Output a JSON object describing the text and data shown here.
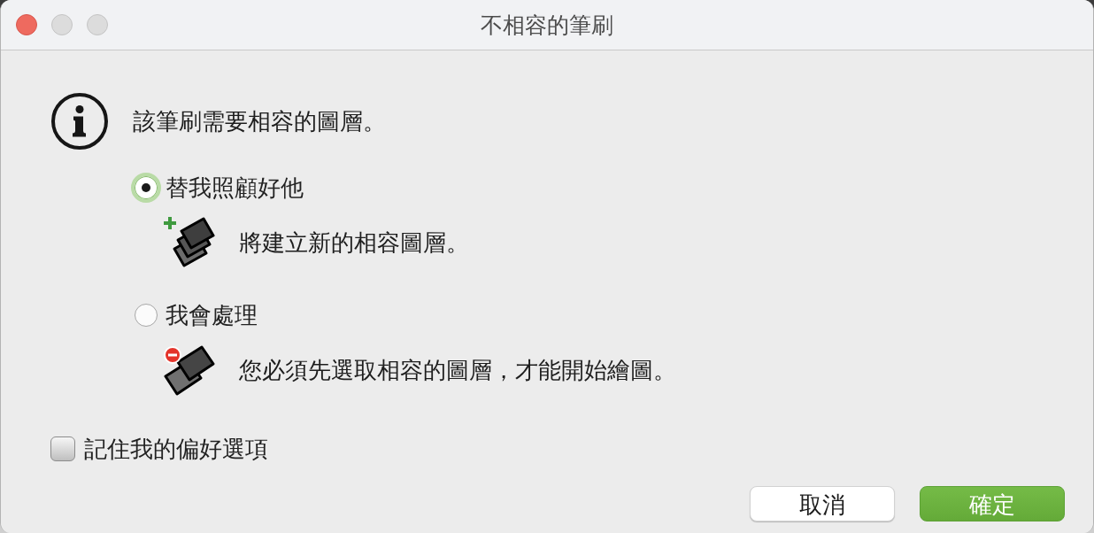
{
  "window": {
    "title": "不相容的筆刷"
  },
  "message": "該筆刷需要相容的圖層。",
  "options": [
    {
      "label": "替我照顧好他",
      "selected": true,
      "kind": "add",
      "description": "將建立新的相容圖層。"
    },
    {
      "label": "我會處理",
      "selected": false,
      "kind": "remove",
      "description": "您必須先選取相容的圖層，才能開始繪圖。"
    }
  ],
  "remember": {
    "label": "記住我的偏好選項",
    "checked": false
  },
  "buttons": [
    {
      "label": "取消",
      "kind": "cancel"
    },
    {
      "label": "確定",
      "kind": "default"
    }
  ]
}
